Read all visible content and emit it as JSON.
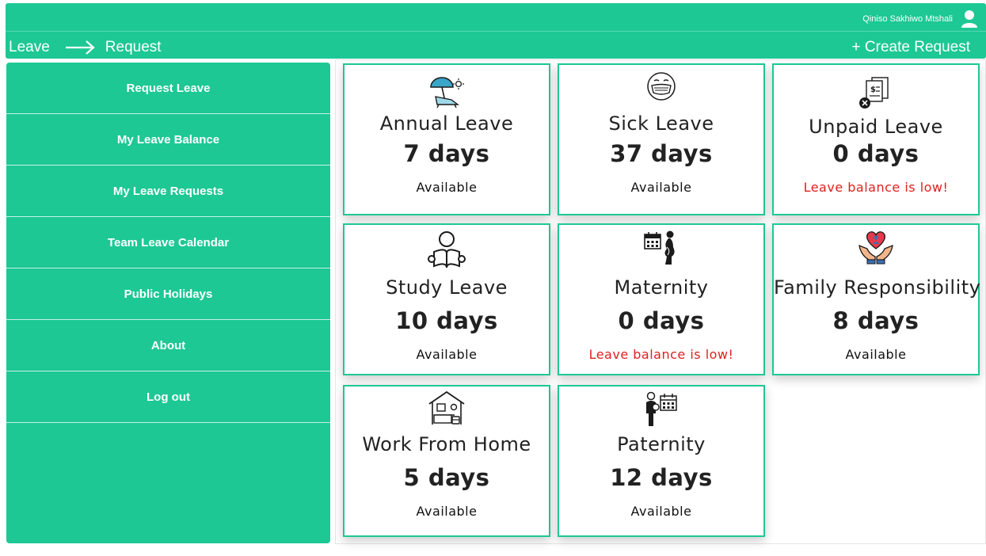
{
  "header": {
    "user_name": "Qiniso Sakhiwo Mtshali",
    "avatar_icon": "user-avatar-icon",
    "breadcrumb": {
      "parent": "Leave",
      "current": "Request",
      "separator_icon": "arrow-right-icon"
    },
    "create_request_label": "+ Create Request"
  },
  "sidebar": {
    "items": [
      {
        "label": "Request Leave"
      },
      {
        "label": "My Leave Balance"
      },
      {
        "label": "My Leave Requests"
      },
      {
        "label": "Team Leave Calendar"
      },
      {
        "label": "Public Holidays"
      },
      {
        "label": "About"
      },
      {
        "label": "Log out"
      }
    ]
  },
  "cards": [
    {
      "title": "Annual Leave",
      "days": "7 days",
      "status": "Available",
      "icon": "beach-chair-umbrella-icon"
    },
    {
      "title": "Sick Leave",
      "days": "37 days",
      "status": "Available",
      "icon": "face-mask-icon"
    },
    {
      "title": "Unpaid Leave",
      "days": "0 days",
      "status": "Leave balance is low!",
      "icon": "unpaid-invoice-icon"
    },
    {
      "title": "Study Leave",
      "days": "10 days",
      "status": "Available",
      "icon": "person-reading-book-icon"
    },
    {
      "title": "Maternity",
      "days": "0 days",
      "status": "Leave balance is low!",
      "icon": "calendar-pregnant-woman-icon"
    },
    {
      "title": "Family Responsibility",
      "days": "8 days",
      "status": "Available",
      "icon": "hands-heart-family-icon"
    },
    {
      "title": "Work From Home",
      "days": "5 days",
      "status": "Available",
      "icon": "home-office-desk-icon"
    },
    {
      "title": "Paternity",
      "days": "12 days",
      "status": "Available",
      "icon": "father-baby-calendar-icon"
    }
  ],
  "colors": {
    "brand": "#1dc895",
    "low_balance": "#e02020",
    "text": "#222222"
  }
}
